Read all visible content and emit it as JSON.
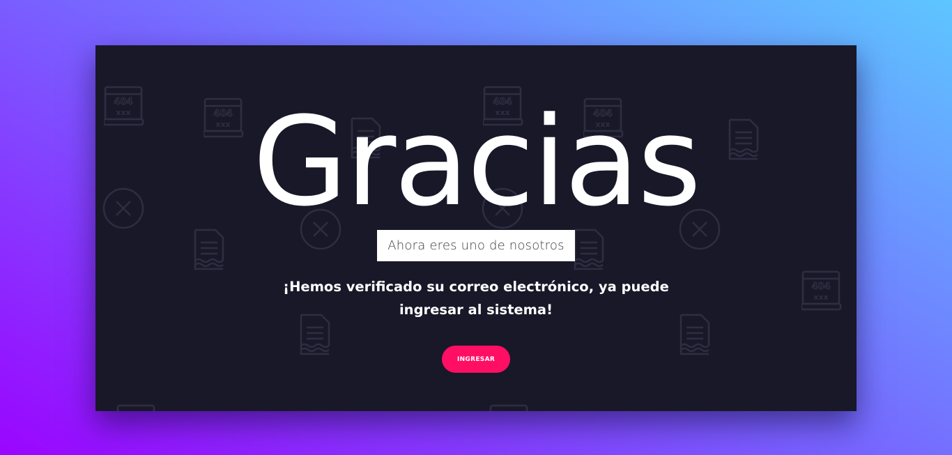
{
  "page": {
    "title": "Gracias",
    "subtitle": "Ahora eres uno de nosotros",
    "message": "¡Hemos verificado su correo electrónico, ya puede ingresar al sistema!",
    "button_label": "INGRESAR"
  },
  "decor": {
    "icon_404_text": "404",
    "icon_404_subtext": "xxx"
  },
  "colors": {
    "background_gradient_start": "#9a05ff",
    "background_gradient_end": "#5ec6ff",
    "card_background": "#181828",
    "title_color": "#ffffff",
    "button_color": "#ff0f63",
    "decor_icon_color": "#2e2e42"
  }
}
